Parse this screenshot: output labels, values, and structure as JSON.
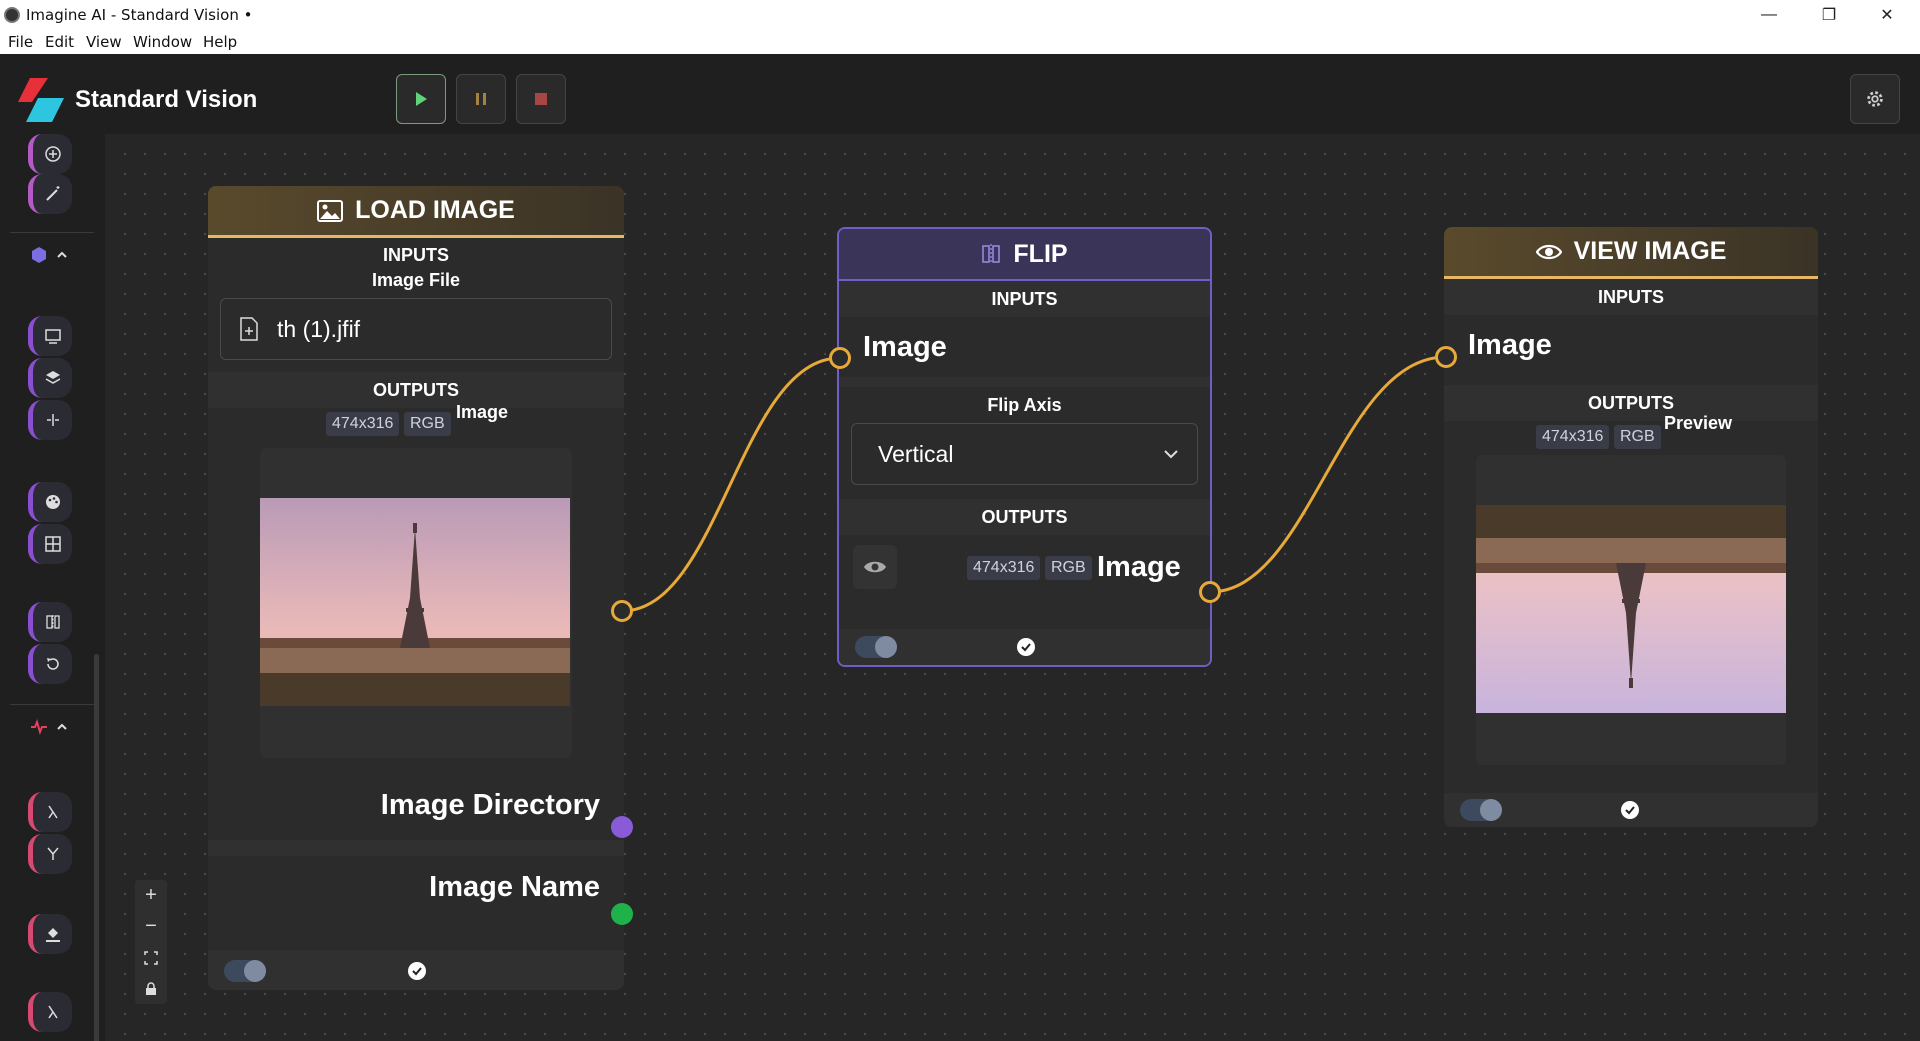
{
  "window": {
    "title": "Imagine AI - Standard Vision •",
    "minimize": "—",
    "maximize": "❐",
    "close": "✕"
  },
  "menu": [
    "File",
    "Edit",
    "View",
    "Window",
    "Help"
  ],
  "header": {
    "app_name": "Standard Vision",
    "play_icon": "play-icon",
    "pause_icon": "pause-icon",
    "stop_icon": "stop-icon",
    "settings_icon": "gear-icon"
  },
  "nodes": {
    "load_image": {
      "title": "LOAD IMAGE",
      "inputs_label": "INPUTS",
      "input_name": "Image File",
      "file_value": "th (1).jfif",
      "outputs_label": "OUTPUTS",
      "size_chip": "474x316",
      "mode_chip": "RGB",
      "output_name": "Image",
      "output_directory": "Image Directory",
      "output_image_name": "Image Name"
    },
    "flip": {
      "title": "FLIP",
      "inputs_label": "INPUTS",
      "input_image": "Image",
      "axis_label": "Flip Axis",
      "axis_value": "Vertical",
      "outputs_label": "OUTPUTS",
      "size_chip": "474x316",
      "mode_chip": "RGB",
      "output_name": "Image"
    },
    "view_image": {
      "title": "VIEW IMAGE",
      "inputs_label": "INPUTS",
      "input_image": "Image",
      "outputs_label": "OUTPUTS",
      "size_chip": "474x316",
      "mode_chip": "RGB",
      "output_name": "Preview"
    }
  },
  "colors": {
    "accent_gold": "#e6b866",
    "wire": "#e6a93a",
    "purple_accent": "#6f5ec8",
    "directory_port": "#8a5bd8",
    "name_port": "#1fb24a"
  }
}
